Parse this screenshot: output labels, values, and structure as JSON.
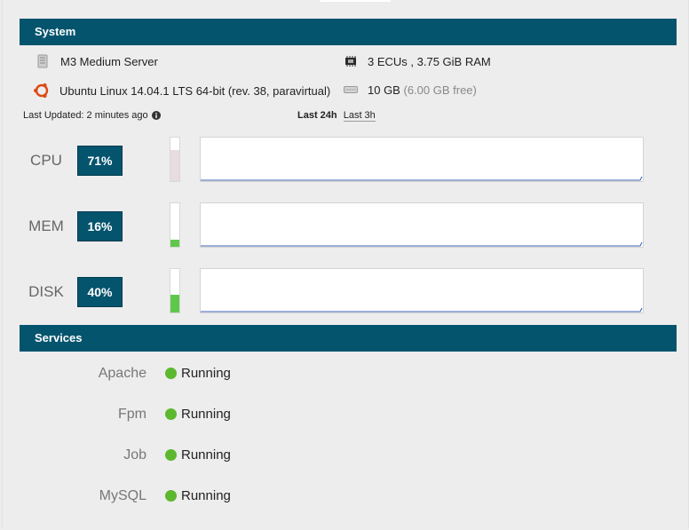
{
  "system": {
    "header": "System",
    "server_type": "M3 Medium Server",
    "cpu_ram": "3 ECUs , 3.75 GiB RAM",
    "ecus_label": "ECUs",
    "os": "Ubuntu Linux 14.04.1 LTS 64-bit (rev. 38, paravirtual)",
    "disk_size": "10 GB",
    "disk_free": "(6.00 GB free)",
    "last_updated": "Last Updated: 2 minutes ago",
    "range_options": [
      "Last 24h",
      "Last 3h"
    ],
    "range_selected": "Last 24h"
  },
  "metrics": [
    {
      "label": "CPU",
      "value": "71%",
      "level": 0.71,
      "color": "#e8dcde"
    },
    {
      "label": "MEM",
      "value": "16%",
      "level": 0.16,
      "color": "#5fc84a"
    },
    {
      "label": "DISK",
      "value": "40%",
      "level": 0.4,
      "color": "#5fc84a"
    }
  ],
  "services": {
    "header": "Services",
    "items": [
      {
        "name": "Apache",
        "status": "Running"
      },
      {
        "name": "Fpm",
        "status": "Running"
      },
      {
        "name": "Job",
        "status": "Running"
      },
      {
        "name": "MySQL",
        "status": "Running"
      }
    ],
    "status_color": "#5cb82e"
  },
  "colors": {
    "accent": "#05546e",
    "graph_line": "#3a5fb0"
  },
  "icons": {
    "server": "server-icon",
    "chip": "chip-icon",
    "ubuntu": "ubuntu-logo-icon",
    "disk": "disk-icon",
    "info": "info-circle-icon"
  }
}
